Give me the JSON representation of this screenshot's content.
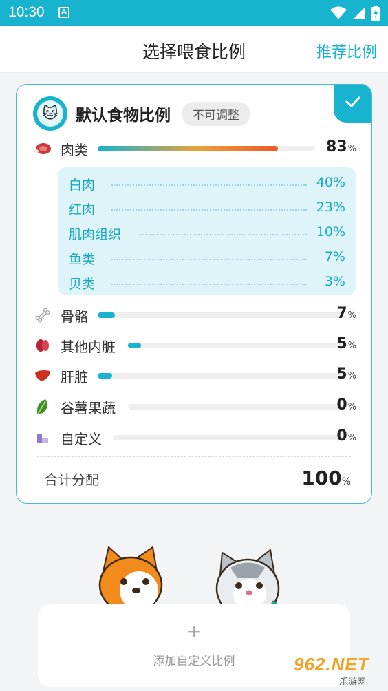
{
  "status_bar": {
    "time": "10:30",
    "notification_letter": "A"
  },
  "app_bar": {
    "title": "选择喂食比例",
    "action": "推荐比例"
  },
  "card": {
    "title": "默认食物比例",
    "badge": "不可调整",
    "selected": true,
    "accent_color": "#17b3cf",
    "meat": {
      "label": "肉类",
      "value": "83",
      "unit": "%",
      "fraction": 0.83,
      "icon": "meat-icon"
    },
    "meat_breakdown": [
      {
        "label": "白肉",
        "value": "40%"
      },
      {
        "label": "红肉",
        "value": "23%"
      },
      {
        "label": "肌肉组织",
        "value": "10%"
      },
      {
        "label": "鱼类",
        "value": "7%"
      },
      {
        "label": "贝类",
        "value": "3%"
      }
    ],
    "items": [
      {
        "label": "骨骼",
        "value": "7",
        "unit": "%",
        "fraction": 0.07,
        "icon": "bone-icon"
      },
      {
        "label": "其他内脏",
        "value": "5",
        "unit": "%",
        "fraction": 0.05,
        "icon": "kidney-icon"
      },
      {
        "label": "肝脏",
        "value": "5",
        "unit": "%",
        "fraction": 0.05,
        "icon": "liver-icon"
      },
      {
        "label": "谷薯果蔬",
        "value": "0",
        "unit": "%",
        "fraction": 0,
        "icon": "vegetable-icon"
      },
      {
        "label": "自定义",
        "value": "0",
        "unit": "%",
        "fraction": 0,
        "icon": "custom-icon"
      }
    ],
    "total": {
      "label": "合计分配",
      "value": "100",
      "unit": "%"
    }
  },
  "add_custom": {
    "icon": "plus-icon",
    "label": "添加自定义比例"
  },
  "watermark": {
    "main": "962.NET",
    "sub": "乐游网"
  }
}
